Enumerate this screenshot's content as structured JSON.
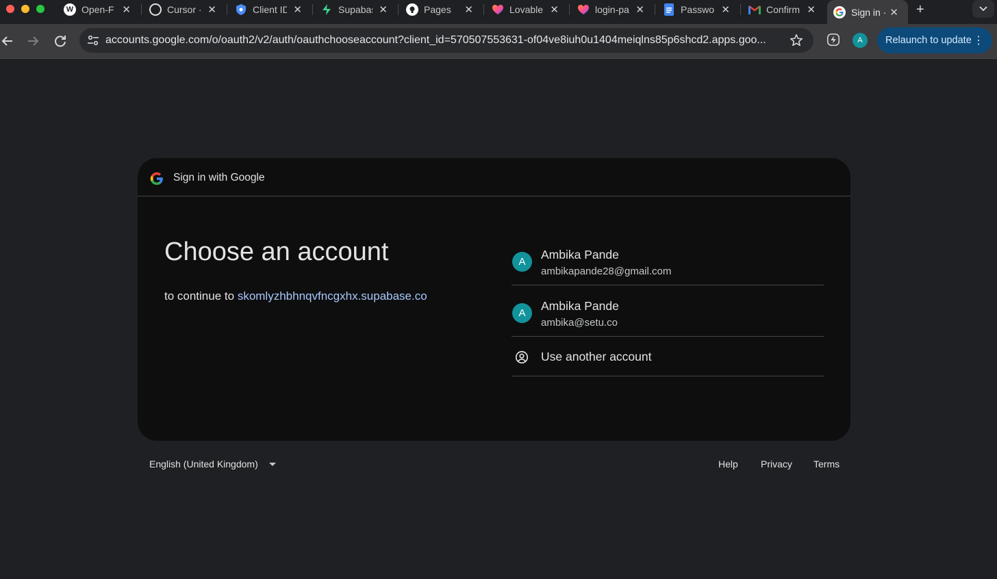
{
  "tabs": [
    {
      "title": "Open-F",
      "icon": "wordpress-icon",
      "color": "#ffffff"
    },
    {
      "title": "Cursor ·",
      "icon": "openai-icon",
      "color": "#ffffff"
    },
    {
      "title": "Client ID",
      "icon": "shield-icon",
      "color": "#4c8df6"
    },
    {
      "title": "Supabase",
      "icon": "supabase-icon",
      "color": "#3ecf8e"
    },
    {
      "title": "Pages",
      "icon": "github-icon",
      "color": "#ffffff"
    },
    {
      "title": "Lovable",
      "icon": "lovable-heart-icon",
      "color": "#ff5c8a"
    },
    {
      "title": "login-pa",
      "icon": "lovable-heart-icon",
      "color": "#ff5c8a"
    },
    {
      "title": "Passwor",
      "icon": "google-docs-icon",
      "color": "#4285f4"
    },
    {
      "title": "Confirm",
      "icon": "gmail-icon",
      "color": "#ea4335"
    },
    {
      "title": "Sign in ·",
      "icon": "google-g-icon",
      "color": "#ffffff"
    }
  ],
  "new_tab_label": "+",
  "address_bar": {
    "url": "accounts.google.com/o/oauth2/v2/auth/oauthchooseaccount?client_id=570507553631-of04ve8iuh0u1404meiqlns85p6shcd2.apps.goo..."
  },
  "profile_initial": "A",
  "relaunch_label": "Relaunch to update",
  "card": {
    "header_title": "Sign in with Google",
    "heading": "Choose an account",
    "continue_prefix": "to continue to ",
    "continue_link": "skomlyzhbhnqvfncgxhx.supabase.co",
    "accounts": [
      {
        "initial": "A",
        "name": "Ambika Pande",
        "email": "ambikapande28@gmail.com"
      },
      {
        "initial": "A",
        "name": "Ambika Pande",
        "email": "ambika@setu.co"
      }
    ],
    "use_another": "Use another account"
  },
  "footer": {
    "language": "English (United Kingdom)",
    "help": "Help",
    "privacy": "Privacy",
    "terms": "Terms"
  },
  "colors": {
    "accent_link": "#a8c7fa",
    "avatar": "#12939c",
    "relaunch_bg": "#0d4a7a"
  }
}
